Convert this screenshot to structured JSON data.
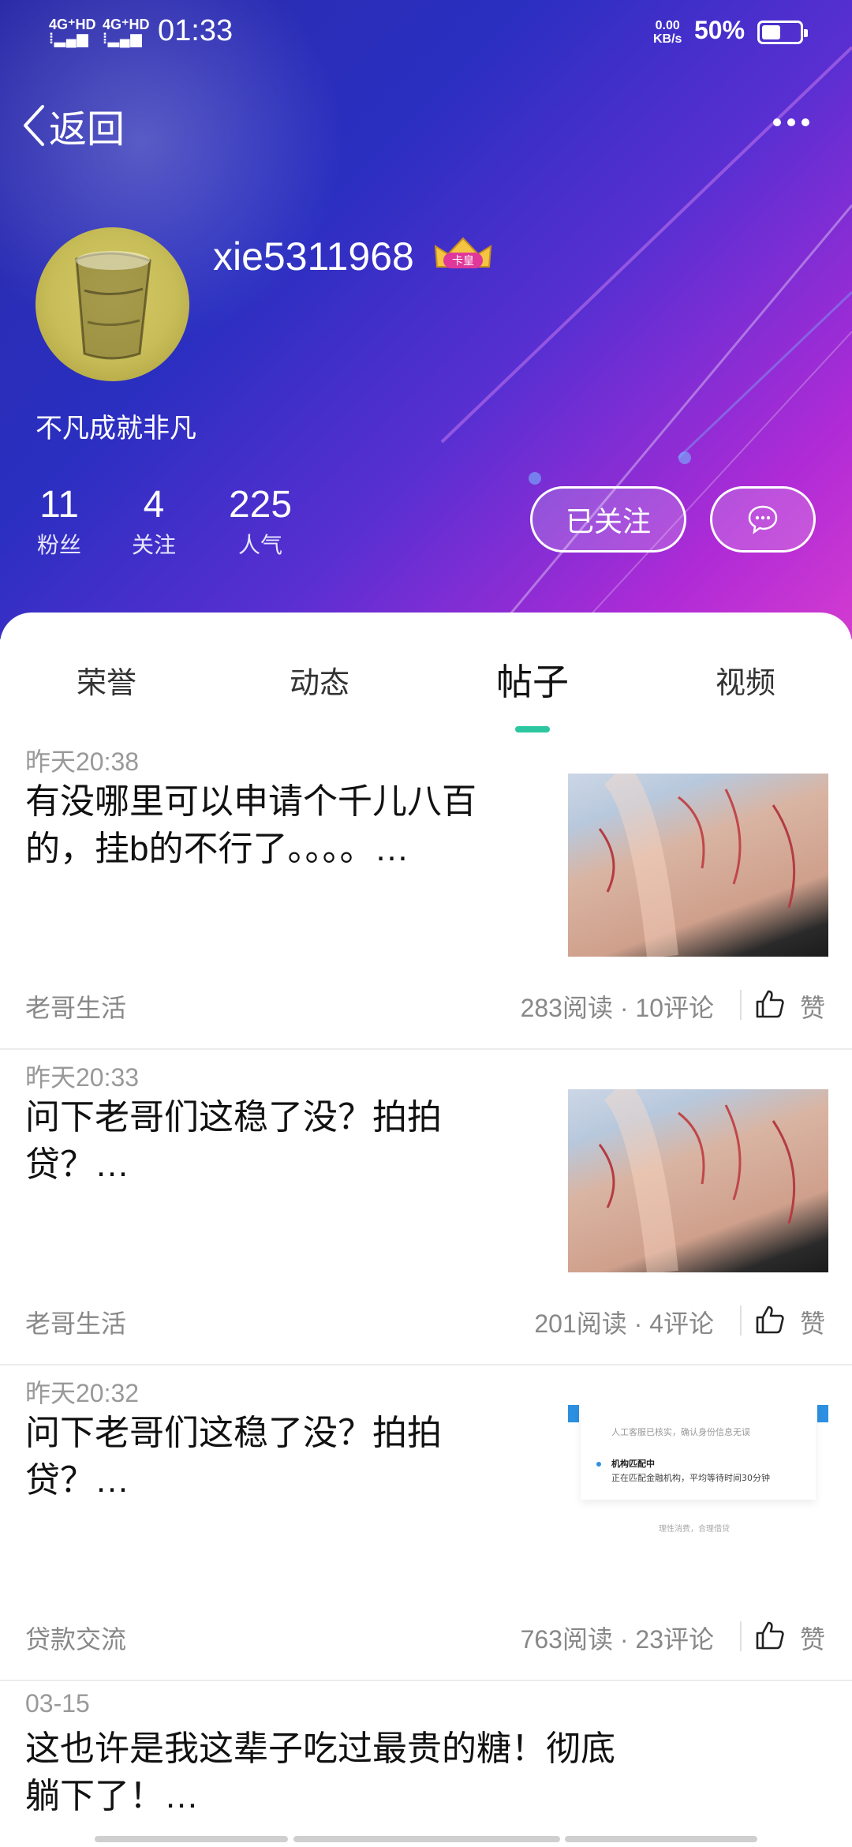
{
  "status": {
    "sig1": "4G⁺HD",
    "sig2": "4G⁺HD",
    "time": "01:33",
    "kbs_value": "0.00",
    "kbs_unit": "KB/s",
    "battery": "50%",
    "battery_level": 0.5
  },
  "nav": {
    "back_label": "返回"
  },
  "profile": {
    "username": "xie5311968",
    "badge_text": "卡皇",
    "bio": "不凡成就非凡",
    "stats": [
      {
        "value": "11",
        "label": "粉丝"
      },
      {
        "value": "4",
        "label": "关注"
      },
      {
        "value": "225",
        "label": "人气"
      }
    ],
    "follow_label": "已关注"
  },
  "tabs": [
    {
      "label": "荣誉"
    },
    {
      "label": "动态"
    },
    {
      "label": "帖子"
    },
    {
      "label": "视频"
    }
  ],
  "posts": [
    {
      "date": "昨天20:38",
      "title": "有没哪里可以申请个千儿八百的，挂b的不行了。。。。…",
      "category": "老哥生活",
      "meta": "283阅读 · 10评论",
      "like": "赞",
      "thumb": "photo"
    },
    {
      "date": "昨天20:33",
      "title": "问下老哥们这稳了没？拍拍贷？…",
      "category": "老哥生活",
      "meta": "201阅读 · 4评论",
      "like": "赞",
      "thumb": "photo"
    },
    {
      "date": "昨天20:32",
      "title": "问下老哥们这稳了没？拍拍贷？…",
      "category": "贷款交流",
      "meta": "763阅读 · 23评论",
      "like": "赞",
      "thumb": "screenshot",
      "thumb_text": {
        "line1": "人工客服已核实，确认身份信息无误",
        "line2": "机构匹配中",
        "line3": "正在匹配金融机构，平均等待时间30分钟",
        "line4": "理性消费，合理借贷"
      }
    },
    {
      "date": "03-15",
      "title": "这也许是我这辈子吃过最贵的糖！彻底躺下了！…"
    }
  ]
}
